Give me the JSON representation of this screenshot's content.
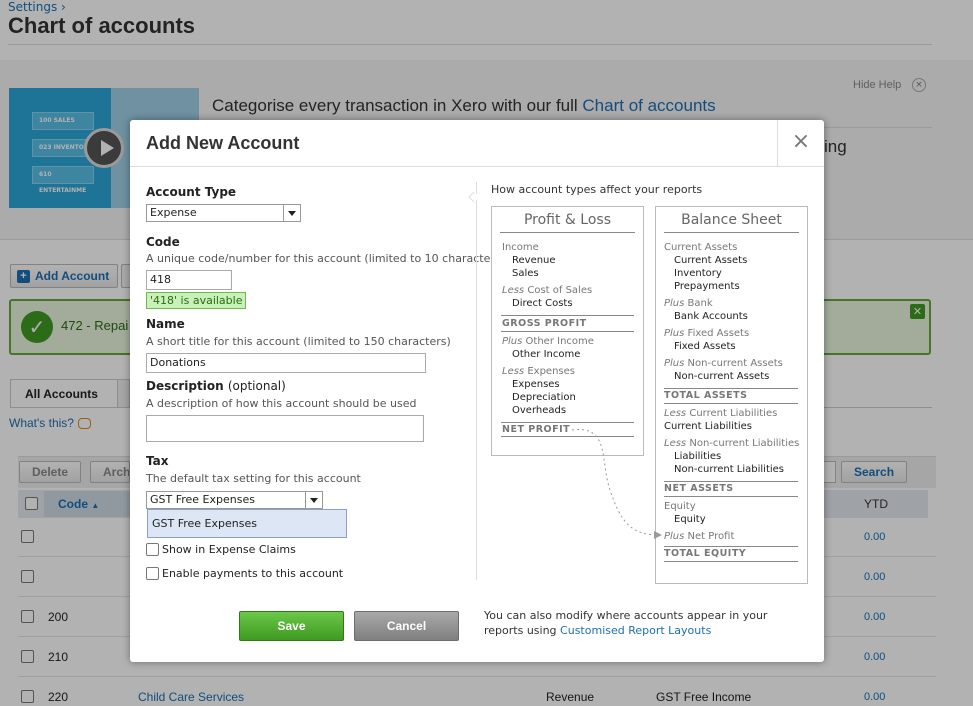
{
  "page": {
    "breadcrumb": "Settings",
    "breadcrumb_sep": "›",
    "title": "Chart of accounts"
  },
  "help": {
    "hide_label": "Hide Help",
    "hide_x": "×",
    "heading_prefix": "Categorise every transaction in Xero with our full ",
    "heading_link": "Chart of accounts",
    "partial_text": "ing",
    "video_chips": [
      "100 SALES",
      "023 INVENTORY",
      "610 ENTERTAINME"
    ]
  },
  "actions": {
    "add_account": "Add Account",
    "add_icon": "+"
  },
  "success": {
    "message": "472 - Repai",
    "check": "✓",
    "close": "✕"
  },
  "tabs": {
    "all_accounts": "All Accounts",
    "second_fragment": "A"
  },
  "whats_this": "What's this?",
  "toolbar": {
    "delete": "Delete",
    "archive": "Arch",
    "search": "Search"
  },
  "table": {
    "headers": {
      "code": "Code",
      "sort": "▲",
      "ytd": "YTD"
    },
    "rows": [
      {
        "code": "",
        "name": "",
        "type": "",
        "tax": "",
        "ytd": "0.00"
      },
      {
        "code": "",
        "name": "",
        "type": "",
        "tax": "",
        "ytd": "0.00"
      },
      {
        "code": "200",
        "name": "",
        "type": "",
        "tax": "",
        "ytd": "0.00"
      },
      {
        "code": "210",
        "name": "",
        "type": "",
        "tax": "",
        "ytd": "0.00"
      },
      {
        "code": "220",
        "name": "Child Care Services",
        "type": "Revenue",
        "tax": "GST Free Income",
        "ytd": "0.00"
      }
    ]
  },
  "modal": {
    "title": "Add New Account",
    "close": "×",
    "account_type": {
      "label": "Account Type",
      "value": "Expense"
    },
    "code": {
      "label": "Code",
      "hint": "A unique code/number for this account (limited to 10 characters)",
      "value": "418",
      "availability": "'418' is available"
    },
    "name": {
      "label": "Name",
      "hint": "A short title for this account (limited to 150 characters)",
      "value": "Donations"
    },
    "description": {
      "label": "Description",
      "optional": "(optional)",
      "hint": "A description of how this account should be used",
      "value": ""
    },
    "tax": {
      "label": "Tax",
      "hint": "The default tax setting for this account",
      "value": "GST Free Expenses",
      "option": "GST Free Expenses"
    },
    "checkboxes": {
      "expense_claims": "Show in Expense Claims",
      "enable_payments": "Enable payments to this account"
    },
    "save": "Save",
    "cancel": "Cancel",
    "footnote_text": "You can also modify where accounts appear in your reports using ",
    "footnote_link": "Customised Report Layouts"
  },
  "reports": {
    "title": "How account types affect your reports",
    "profit_loss": {
      "heading": "Profit & Loss",
      "income": "Income",
      "revenue": "Revenue",
      "sales": "Sales",
      "less": "Less",
      "cost_of_sales": "Cost of Sales",
      "direct_costs": "Direct Costs",
      "gross_profit": "GROSS PROFIT",
      "plus": "Plus",
      "other_income_grp": "Other Income",
      "other_income": "Other Income",
      "expenses_grp": "Expenses",
      "expenses": "Expenses",
      "depreciation": "Depreciation",
      "overheads": "Overheads",
      "net_profit": "NET PROFIT"
    },
    "balance_sheet": {
      "heading": "Balance Sheet",
      "current_assets_grp": "Current Assets",
      "current_assets": "Current Assets",
      "inventory": "Inventory",
      "prepayments": "Prepayments",
      "plus": "Plus",
      "less": "Less",
      "bank_grp": "Bank",
      "bank_accounts": "Bank Accounts",
      "fixed_assets_grp": "Fixed Assets",
      "fixed_assets": "Fixed Assets",
      "noncurrent_assets_grp": "Non-current Assets",
      "noncurrent_assets": "Non-current Assets",
      "total_assets": "TOTAL ASSETS",
      "current_liab_grp": "Current Liabilities",
      "current_liab": "Current Liabilities",
      "noncurrent_liab_grp": "Non-current Liabilities",
      "liabilities": "Liabilities",
      "noncurrent_liab": "Non-current Liabilities",
      "net_assets": "NET ASSETS",
      "equity_grp": "Equity",
      "equity": "Equity",
      "net_profit": "Net Profit",
      "total_equity": "TOTAL EQUITY"
    }
  }
}
